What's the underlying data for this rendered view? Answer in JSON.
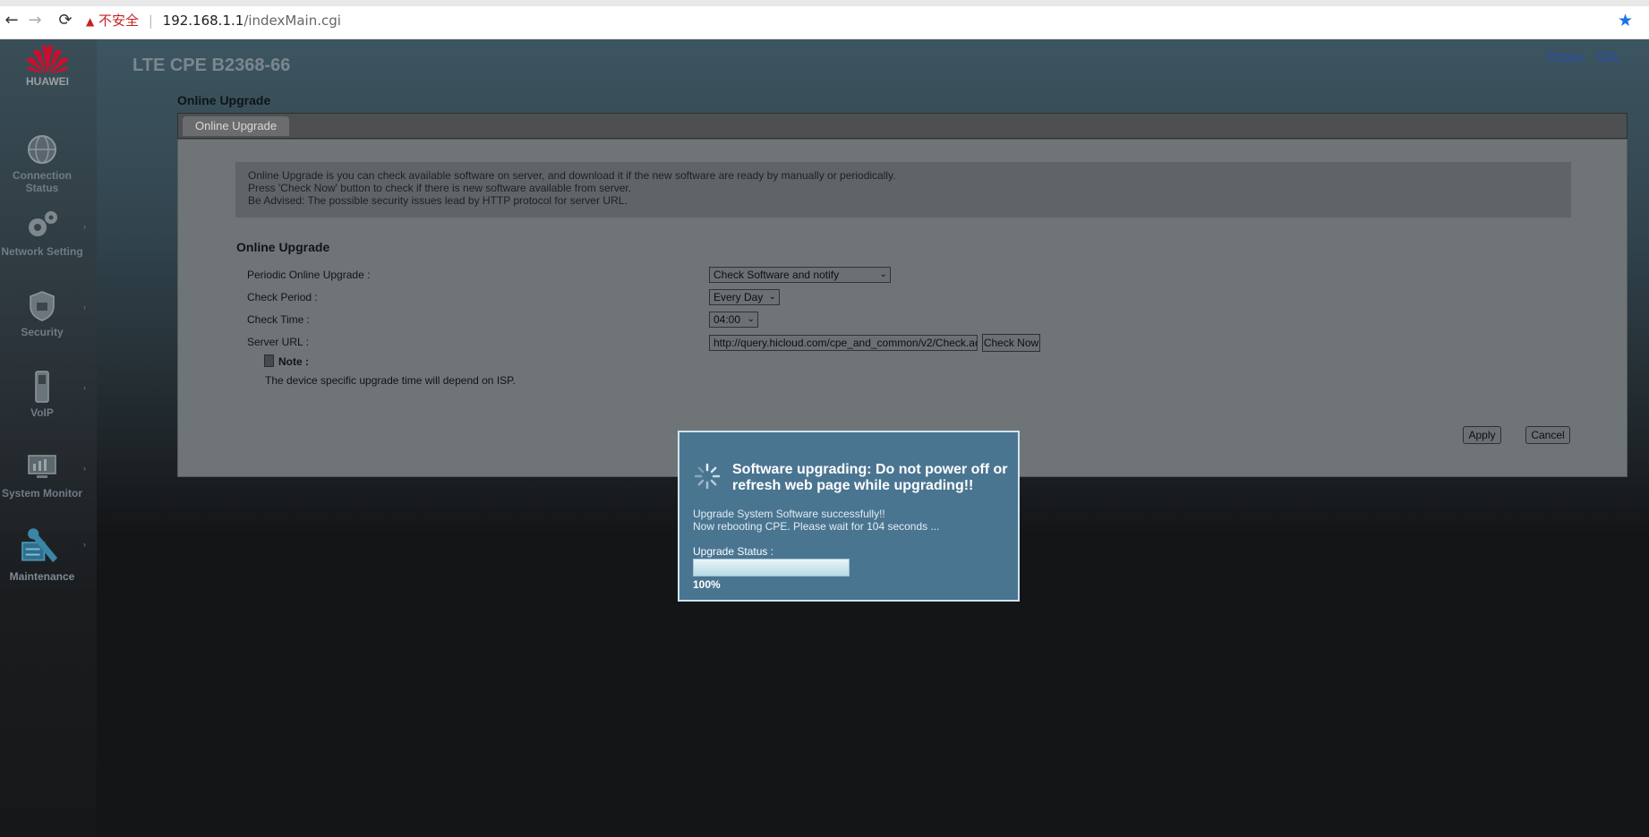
{
  "browser": {
    "back_icon": "←",
    "forward_icon": "→",
    "reload_icon": "⟳",
    "warning_icon": "▲",
    "security_text": "不安全",
    "separator": "|",
    "host": "192.168.1.1",
    "path": "/indexMain.cgi",
    "star_icon": "★"
  },
  "header": {
    "brand": "HUAWEI",
    "product": "LTE CPE B2368-66",
    "links": [
      "Privacy",
      "GPL"
    ]
  },
  "sidebar": {
    "items": [
      {
        "label_line1": "Connection",
        "label_line2": "Status",
        "icon": "globe-icon"
      },
      {
        "label_line1": "Network Setting",
        "label_line2": "",
        "icon": "gears-icon"
      },
      {
        "label_line1": "Security",
        "label_line2": "",
        "icon": "shield-icon"
      },
      {
        "label_line1": "VoIP",
        "label_line2": "",
        "icon": "phone-icon"
      },
      {
        "label_line1": "System Monitor",
        "label_line2": "",
        "icon": "monitor-icon"
      },
      {
        "label_line1": "Maintenance",
        "label_line2": "",
        "icon": "wrench-icon"
      }
    ],
    "arrow": "›"
  },
  "page": {
    "title": "Online Upgrade",
    "tab": "Online Upgrade",
    "info_lines": [
      "Online Upgrade is you can check available software on server, and download it if the new software are ready by manually or periodically.",
      "Press 'Check Now' button to check if there is new software available from server.",
      "Be Advised: The possible security issues lead by HTTP protocol for server URL."
    ],
    "section_title": "Online Upgrade",
    "fields": {
      "periodic_label": "Periodic Online Upgrade :",
      "periodic_value": "Check Software and notify",
      "period_label": "Check Period :",
      "period_value": "Every Day",
      "time_label": "Check Time :",
      "time_value": "04:00",
      "url_label": "Server URL :",
      "url_value": "http://query.hicloud.com/cpe_and_common/v2/Check.ac"
    },
    "check_now": "Check Now",
    "note_title": "Note :",
    "note_text": "The device specific upgrade time will depend on ISP.",
    "apply": "Apply",
    "cancel": "Cancel",
    "dropdown_glyph": "⌄"
  },
  "modal": {
    "title": "Software upgrading: Do not power off or refresh web page while upgrading!!",
    "line1": "Upgrade System Software successfully!!",
    "line2": "Now rebooting CPE. Please wait for 104 seconds ...",
    "status_label": "Upgrade Status :",
    "progress": 1.0,
    "percent": "100%"
  }
}
